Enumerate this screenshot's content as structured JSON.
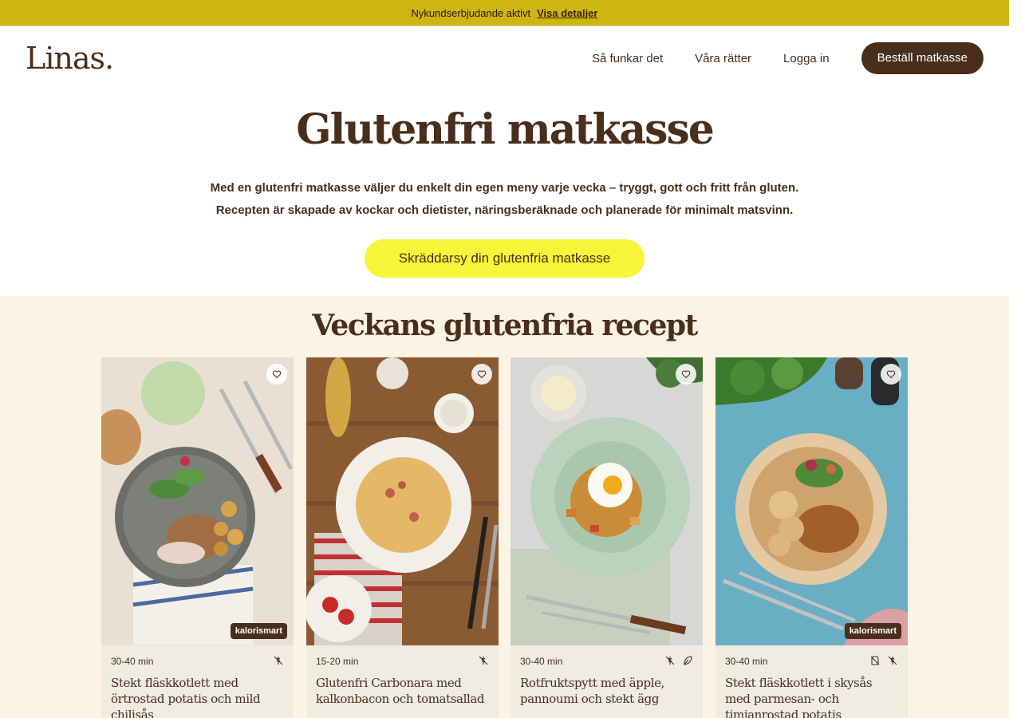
{
  "promo": {
    "text": "Nykundserbjudande aktivt",
    "link": "Visa detaljer"
  },
  "header": {
    "logo": "Linas.",
    "nav": [
      "Så funkar det",
      "Våra rätter",
      "Logga in"
    ],
    "cta": "Beställ matkasse"
  },
  "hero": {
    "title": "Glutenfri matkasse",
    "line1": "Med en glutenfri matkasse väljer du enkelt din egen meny varje vecka – tryggt, gott och fritt från gluten.",
    "line2": "Recepten är skapade av kockar och dietister, näringsberäknade och planerade för minimalt matsvinn.",
    "cta": "Skräddarsy din glutenfria matkasse"
  },
  "recipes": {
    "title": "Veckans glutenfria recept",
    "cards": [
      {
        "time": "30-40 min",
        "title": "Stekt fläskkotlett med örtrostad potatis och mild chilisås",
        "badge": "kalorismart",
        "icons": [
          "gluten-free-icon"
        ]
      },
      {
        "time": "15-20 min",
        "title": "Glutenfri Carbonara med kalkonbacon och tomatsallad",
        "badge": "",
        "icons": [
          "gluten-free-icon"
        ]
      },
      {
        "time": "30-40 min",
        "title": "Rotfruktspytt med äpple, pannoumi och stekt ägg",
        "badge": "",
        "icons": [
          "gluten-free-icon",
          "vegetarian-leaf-icon"
        ]
      },
      {
        "time": "30-40 min",
        "title": "Stekt fläskkotlett i skysås med parmesan- och timjanrostad potatis",
        "badge": "kalorismart",
        "icons": [
          "lactose-free-icon",
          "gluten-free-icon"
        ]
      }
    ]
  },
  "colors": {
    "promo": "#cfb512",
    "brand_brown": "#4a2e1c",
    "hero_cta": "#f5f53a",
    "section_bg": "#fdf3e4"
  }
}
